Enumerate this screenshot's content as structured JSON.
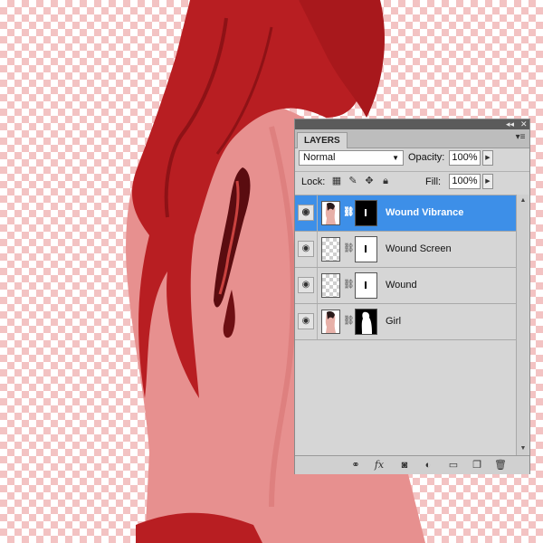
{
  "panel": {
    "title": "LAYERS",
    "menu_icon": "panel-menu-icon",
    "collapse_icon": "collapse-icon",
    "close_icon": "close-icon",
    "blend_mode": "Normal",
    "opacity_label": "Opacity:",
    "opacity_value": "100%",
    "lock_label": "Lock:",
    "fill_label": "Fill:",
    "fill_value": "100%",
    "lock_icons": [
      "lock-transparent-pixels-icon",
      "lock-image-pixels-icon",
      "lock-position-icon",
      "lock-all-icon"
    ],
    "layers": [
      {
        "name": "Wound Vibrance",
        "selected": true,
        "visible": true
      },
      {
        "name": "Wound Screen",
        "selected": false,
        "visible": true
      },
      {
        "name": "Wound",
        "selected": false,
        "visible": true
      },
      {
        "name": "Girl",
        "selected": false,
        "visible": true
      }
    ],
    "bottom_icons": [
      "link-layers-icon",
      "layer-style-icon",
      "add-mask-icon",
      "adjustment-layer-icon",
      "new-group-icon",
      "new-layer-icon",
      "delete-layer-icon"
    ]
  },
  "colors": {
    "selection": "#3d8fe8",
    "checker": "#f3c3c3",
    "subject": "#b81e22"
  }
}
